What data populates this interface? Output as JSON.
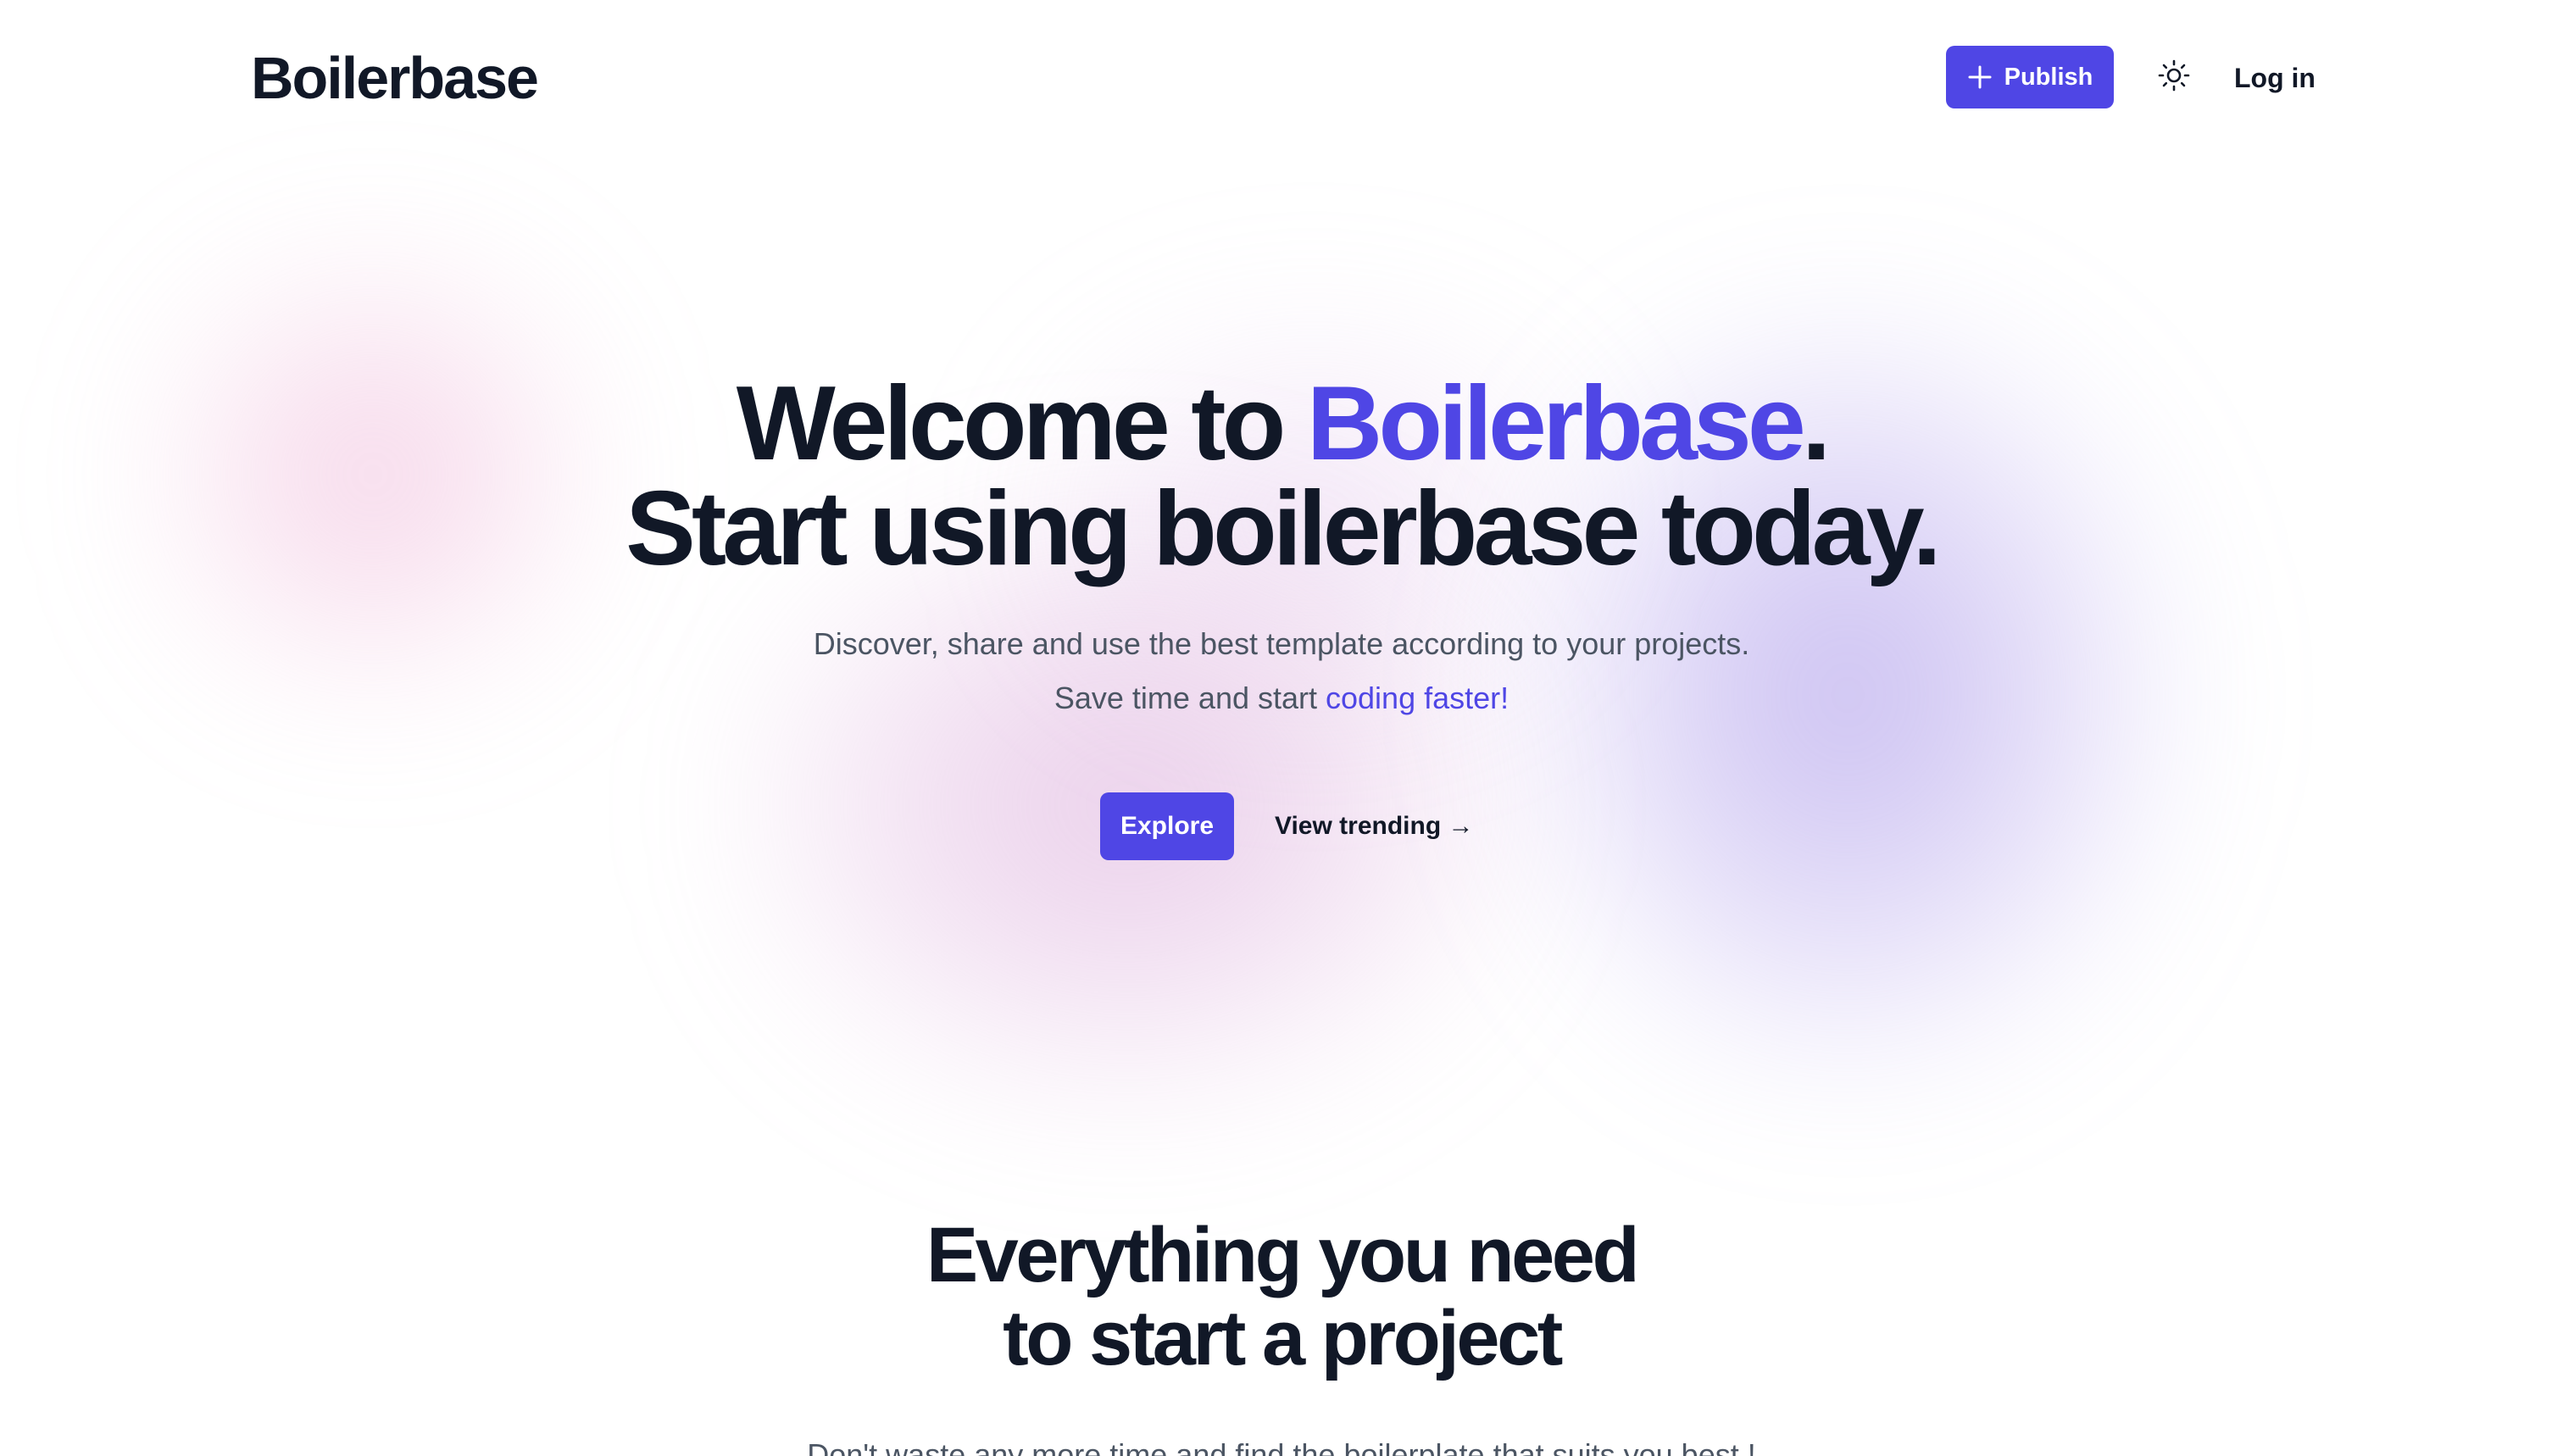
{
  "brand": {
    "name": "Boilerbase",
    "accent_color": "#4f46e5"
  },
  "header": {
    "publish_label": "Publish",
    "publish_icon": "plus-icon",
    "theme_icon": "sun-icon",
    "login_label": "Log in"
  },
  "hero": {
    "title_line1_prefix": "Welcome to ",
    "title_line1_brand": "Boilerbase",
    "title_line1_suffix": ".",
    "title_line2": "Start using boilerbase today.",
    "subtitle_line1": "Discover, share and use the best template according to your projects.",
    "subtitle_line2_prefix": "Save time and start ",
    "subtitle_line2_accent": "coding faster!",
    "explore_label": "Explore",
    "trending_label": "View trending →"
  },
  "features": {
    "title_line1": "Everything you need",
    "title_line2": "to start a project",
    "subtitle": "Don't waste any more time and find the boilerplate that suits you best !"
  }
}
